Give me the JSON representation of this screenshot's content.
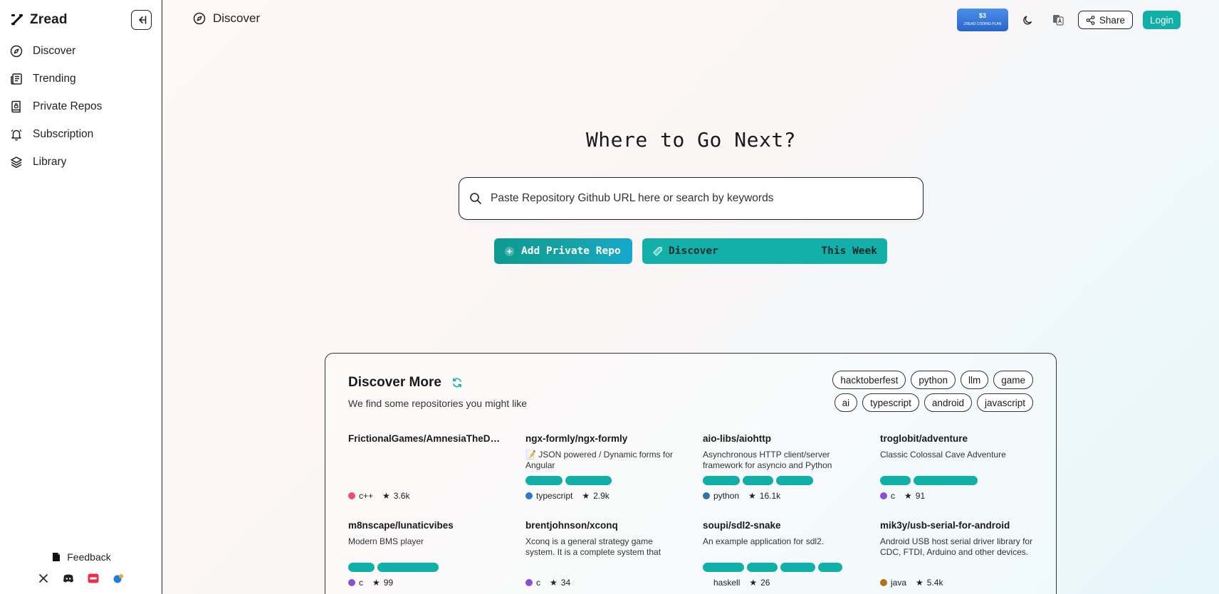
{
  "brand": {
    "name": "Zread"
  },
  "sidebar": {
    "items": [
      {
        "label": "Discover",
        "icon": "compass-icon"
      },
      {
        "label": "Trending",
        "icon": "newspaper-icon"
      },
      {
        "label": "Private Repos",
        "icon": "book-lock-icon"
      },
      {
        "label": "Subscription",
        "icon": "bell-icon"
      },
      {
        "label": "Library",
        "icon": "layers-icon"
      }
    ],
    "feedback_label": "Feedback"
  },
  "topbar": {
    "title": "Discover",
    "promo_text": "$3",
    "promo_sub": "ZREAD CODING PLAN",
    "share_label": "Share",
    "login_label": "Login"
  },
  "hero": {
    "title": "Where to Go Next?",
    "search_placeholder": "Paste Repository Github URL here or search by keywords",
    "add_private_repo": "Add Private Repo",
    "discover_label": "Discover",
    "this_week_label": "This Week"
  },
  "discover_more": {
    "title": "Discover More",
    "subtitle": "We find some repositories you might like",
    "tags": [
      "hacktoberfest",
      "python",
      "llm",
      "game",
      "ai",
      "typescript",
      "android",
      "javascript"
    ],
    "repos": [
      {
        "name": "FrictionalGames/AmnesiaTheDa...",
        "desc": "",
        "lang": "c++",
        "lang_color": "#f34b7d",
        "stars": "3.6k",
        "tag_fills": []
      },
      {
        "name": "ngx-formly/ngx-formly",
        "desc": "📝 JSON powered / Dynamic forms for Angular",
        "lang": "typescript",
        "lang_color": "#3178c6",
        "stars": "2.9k",
        "tag_fills": [
          0.24,
          0.3
        ]
      },
      {
        "name": "aio-libs/aiohttp",
        "desc": "Asynchronous HTTP client/server framework for asyncio and Python",
        "lang": "python",
        "lang_color": "#3572A5",
        "stars": "16.1k",
        "tag_fills": [
          0.24,
          0.2,
          0.24
        ]
      },
      {
        "name": "troglobit/adventure",
        "desc": "Classic Colossal Cave Adventure",
        "lang": "c",
        "lang_color": "#8b4fd6",
        "stars": "91",
        "tag_fills": [
          0.2,
          0.42
        ]
      },
      {
        "name": "m8nscape/lunaticvibes",
        "desc": "Modern BMS player",
        "lang": "c",
        "lang_color": "#8b4fd6",
        "stars": "99",
        "tag_fills": [
          0.17,
          0.4
        ]
      },
      {
        "name": "brentjohnson/xconq",
        "desc": "Xconq is a general strategy game system. It is a complete system that includes all...",
        "lang": "c",
        "lang_color": "#8b4fd6",
        "stars": "34",
        "tag_fills": []
      },
      {
        "name": "soupi/sdl2-snake",
        "desc": "An example application for sdl2.",
        "lang": "haskell",
        "lang_color": "",
        "stars": "26",
        "tag_fills": [
          0.27,
          0.2,
          0.23,
          0.16
        ]
      },
      {
        "name": "mik3y/usb-serial-for-android",
        "desc": "Android USB host serial driver library for CDC, FTDI, Arduino and other devices.",
        "lang": "java",
        "lang_color": "#b07219",
        "stars": "5.4k",
        "tag_fills": []
      }
    ]
  }
}
